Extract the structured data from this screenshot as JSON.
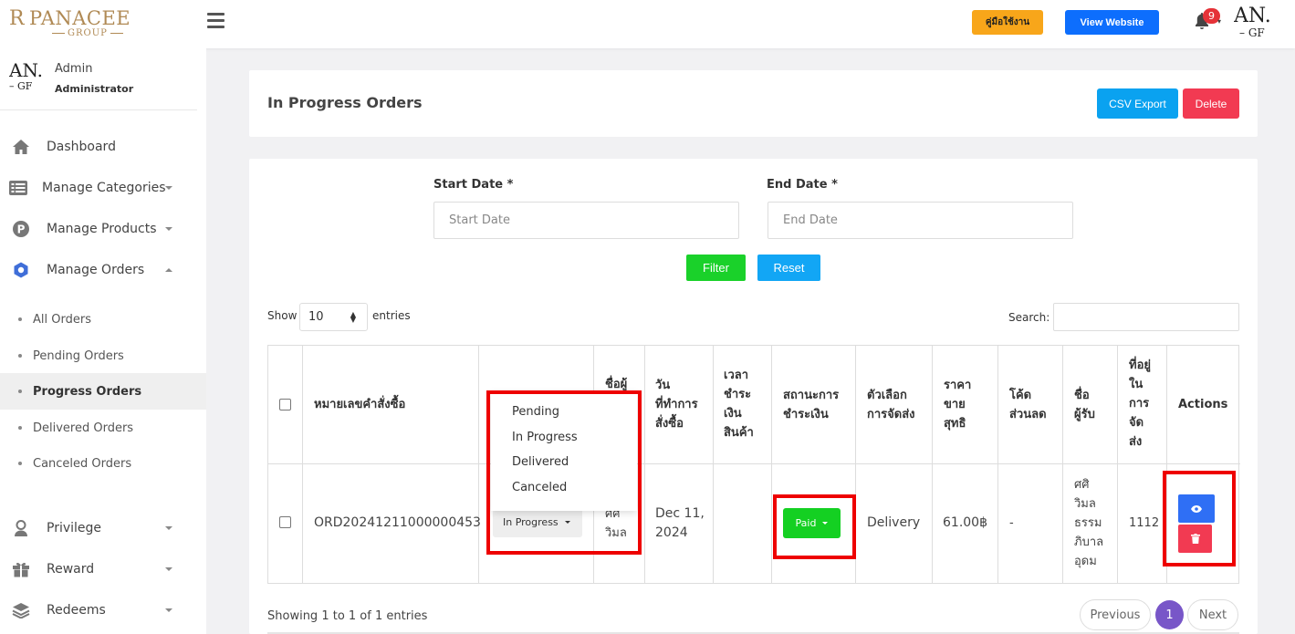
{
  "brand": {
    "mark": "R",
    "name": "PANACEE",
    "group": "GROUP"
  },
  "header": {
    "guide_label": "คู่มือใช้งาน",
    "view_website_label": "View Website",
    "notification_count": "9",
    "avatar_line1": "AN.",
    "avatar_line2": "– GF"
  },
  "user": {
    "name": "Admin",
    "role": "Administrator",
    "avatar_line1": "AN.",
    "avatar_line2": "– GF"
  },
  "sidebar": {
    "items": [
      {
        "label": "Dashboard",
        "icon": "home-icon"
      },
      {
        "label": "Manage Categories",
        "icon": "list-icon"
      },
      {
        "label": "Manage Products",
        "icon": "p-circle-icon"
      },
      {
        "label": "Manage Orders",
        "icon": "orders-icon"
      },
      {
        "label": "Privilege",
        "icon": "user-icon"
      },
      {
        "label": "Reward",
        "icon": "gift-icon"
      },
      {
        "label": "Redeems",
        "icon": "layers-icon"
      }
    ],
    "orders_sub": [
      {
        "label": "All Orders"
      },
      {
        "label": "Pending Orders"
      },
      {
        "label": "Progress Orders"
      },
      {
        "label": "Delivered Orders"
      },
      {
        "label": "Canceled Orders"
      }
    ]
  },
  "page": {
    "title": "In Progress Orders",
    "csv_label": "CSV Export",
    "delete_label": "Delete"
  },
  "filters": {
    "start_label": "Start Date *",
    "start_placeholder": "Start Date",
    "end_label": "End Date *",
    "end_placeholder": "End Date",
    "filter_label": "Filter",
    "reset_label": "Reset"
  },
  "table_controls": {
    "show_label": "Show",
    "entries_value": "10",
    "entries_label": "entries",
    "search_label": "Search:"
  },
  "table": {
    "headers": [
      "หมายเลขคำสั่งซื้อ",
      "",
      "ชื่อผู้",
      "วัน\nที่ทำการ\nสั่งซื้อ",
      "เวลา\nชำระ\nเงิน\nสินค้า",
      "สถานะการ\nชำระเงิน",
      "ตัวเลือก\nการจัดส่ง",
      "ราคา\nขาย\nสุทธิ",
      "โค้ด\nส่วนลด",
      "ชื่อ\nผู้รับ",
      "ที่อยู่\nใน\nการ\nจัด\nส่ง",
      "Actions"
    ],
    "row": {
      "order_no": "ORD20241211000000453",
      "status": "In Progress",
      "customer": "ศศิ\nวิมล",
      "date": "Dec 11,\n2024",
      "pay_time": "",
      "payment_status": "Paid",
      "shipping": "Delivery",
      "net_price": "61.00฿",
      "discount": "-",
      "recipient": "ศศิ\nวิมล\nธรรม\nภิบาล\nอุดม",
      "address": "1112"
    }
  },
  "status_dropdown": {
    "options": [
      "Pending",
      "In Progress",
      "Delivered",
      "Canceled"
    ]
  },
  "pagination": {
    "info": "Showing 1 to 1 of 1 entries",
    "previous": "Previous",
    "current": "1",
    "next": "Next"
  },
  "colors": {
    "highlight": "#ee0000",
    "accent": "#7856c8",
    "paid": "#14d022",
    "view": "#2f6ff5",
    "delete": "#f23a52"
  }
}
